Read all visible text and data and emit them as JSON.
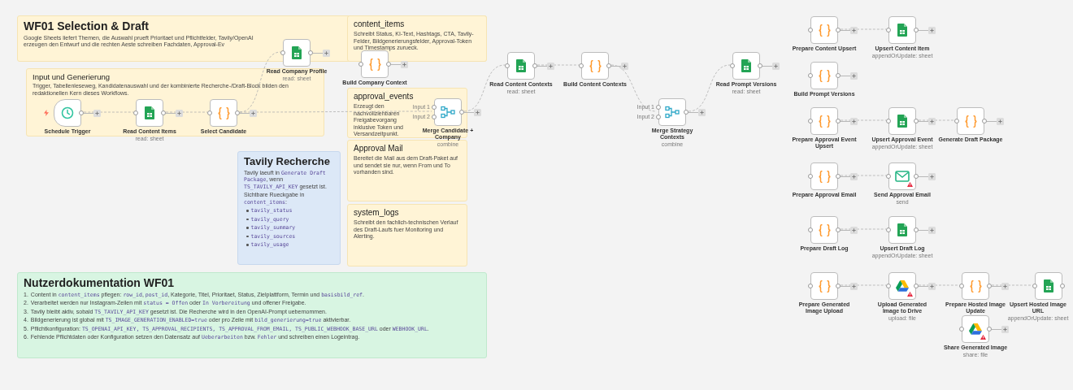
{
  "notes": [
    {
      "kind": "yellow",
      "title": "WF01 Selection & Draft",
      "blocks": [
        {
          "kind": "p",
          "parts": [
            {
              "text": "Google Sheets liefert Themen, die Auswahl prueft Prioritaet und Pflichtfelder, Tavily/OpenAI erzeugen den Entwurf und die rechten Aeste schreiben Fachdaten, Approval-Ev"
            }
          ]
        }
      ]
    },
    {
      "kind": "yellow",
      "title": "content_items",
      "blocks": [
        {
          "kind": "p",
          "parts": [
            {
              "text": "Schreibt Status, KI-Text, Hashtags, CTA, Tavily-Felder, Bildgenerierungsfelder, Approval-Token und Timestamps zurueck."
            }
          ]
        }
      ]
    },
    {
      "kind": "yellow",
      "title": "Input und Generierung",
      "blocks": [
        {
          "kind": "p",
          "parts": [
            {
              "text": "Trigger, Tabellenleseweg, Kandidatenauswahl und der kombinierte Recherche-/Draft-Block bilden den redaktionellen Kern dieses Workflows."
            }
          ]
        }
      ]
    },
    {
      "kind": "yellow",
      "title": "approval_events",
      "blocks": [
        {
          "kind": "p",
          "parts": [
            {
              "text": "Erzeugt den nachvollziehbaren Freigabevorgang inklusive Token und Versandzeitpunkt."
            }
          ]
        }
      ]
    },
    {
      "kind": "blue",
      "title": "Tavily Recherche",
      "blocks": [
        {
          "kind": "p",
          "parts": [
            {
              "text": "Tavily laeuft in "
            },
            {
              "text": "Generate Draft Package",
              "code": true
            },
            {
              "text": ", wenn "
            },
            {
              "text": "TS_TAVILY_API_KEY",
              "code": true
            },
            {
              "text": " gesetzt ist."
            }
          ]
        },
        {
          "kind": "p",
          "parts": [
            {
              "text": "Sichtbare Rueckgabe in "
            },
            {
              "text": "content_items",
              "code": true
            },
            {
              "text": ":"
            }
          ]
        },
        {
          "kind": "bullet",
          "parts": [
            {
              "text": "tavily_status",
              "code": true
            }
          ]
        },
        {
          "kind": "bullet",
          "parts": [
            {
              "text": "tavily_query",
              "code": true
            }
          ]
        },
        {
          "kind": "bullet",
          "parts": [
            {
              "text": "tavily_summary",
              "code": true
            }
          ]
        },
        {
          "kind": "bullet",
          "parts": [
            {
              "text": "tavily_sources",
              "code": true
            }
          ]
        },
        {
          "kind": "bullet",
          "parts": [
            {
              "text": "tavily_usage",
              "code": true
            }
          ]
        }
      ]
    },
    {
      "kind": "yellow",
      "title": "Approval Mail",
      "blocks": [
        {
          "kind": "p",
          "parts": [
            {
              "text": "Bereitet die Mail aus dem Draft-Paket auf und sendet sie nur, wenn From und To vorhanden sind."
            }
          ]
        }
      ]
    },
    {
      "kind": "yellow",
      "title": "system_logs",
      "blocks": [
        {
          "kind": "p",
          "parts": [
            {
              "text": "Schreibt den fachlich-technischen Verlauf des Draft-Laufs fuer Monitoring und Alerting."
            }
          ]
        }
      ]
    },
    {
      "kind": "green",
      "title": "Nutzerdokumentation WF01",
      "blocks": [
        {
          "kind": "numbered",
          "marker": "1.",
          "parts": [
            {
              "text": "Content in "
            },
            {
              "text": "content_items",
              "code": true
            },
            {
              "text": " pflegen: "
            },
            {
              "text": "row_id",
              "code": true
            },
            {
              "text": ", "
            },
            {
              "text": "post_id",
              "code": true
            },
            {
              "text": ", Kategorie, Titel, Prioritaet, Status, Zielplattform, Termin und "
            },
            {
              "text": "basisbild_ref",
              "code": true
            },
            {
              "text": "."
            }
          ]
        },
        {
          "kind": "numbered",
          "marker": "2.",
          "parts": [
            {
              "text": "Verarbeitet werden nur Instagram-Zeilen mit "
            },
            {
              "text": "status = Offen",
              "code": true
            },
            {
              "text": " oder "
            },
            {
              "text": "In Vorbereitung",
              "code": true
            },
            {
              "text": " und offener Freigabe."
            }
          ]
        },
        {
          "kind": "numbered",
          "marker": "3.",
          "parts": [
            {
              "text": "Tavily bleibt aktiv, sobald "
            },
            {
              "text": "TS_TAVILY_API_KEY",
              "code": true
            },
            {
              "text": " gesetzt ist. Die Recherche wird in den OpenAI-Prompt uebernommen."
            }
          ]
        },
        {
          "kind": "numbered",
          "marker": "4.",
          "parts": [
            {
              "text": "Bildgenerierung ist global mit "
            },
            {
              "text": "TS_IMAGE_GENERATION_ENABLED=true",
              "code": true
            },
            {
              "text": " oder pro Zeile mit "
            },
            {
              "text": "bild_generierung=true",
              "code": true
            },
            {
              "text": " aktivierbar."
            }
          ]
        },
        {
          "kind": "numbered",
          "marker": "5.",
          "parts": [
            {
              "text": "Pflichtkonfiguration: "
            },
            {
              "text": "TS_OPENAI_API_KEY, TS_APPROVAL_RECIPIENTS, TS_APPROVAL_FROM_EMAIL, TS_PUBLIC_WEBHOOK_BASE_URL",
              "code": true
            },
            {
              "text": " oder "
            },
            {
              "text": "WEBHOOK_URL",
              "code": true
            },
            {
              "text": "."
            }
          ]
        },
        {
          "kind": "numbered",
          "marker": "6.",
          "parts": [
            {
              "text": "Fehlende Pflichtdaten oder Konfiguration setzen den Datensatz auf "
            },
            {
              "text": "Ueberarbeiten",
              "code": true
            },
            {
              "text": " bzw. "
            },
            {
              "text": "Fehler",
              "code": true
            },
            {
              "text": " und schreiben einen Logeintrag."
            }
          ]
        }
      ]
    }
  ],
  "nodes": [
    {
      "label": "Schedule Trigger",
      "kind": "clock",
      "trigger": true
    },
    {
      "label": "Read Content Items",
      "kind": "sheets",
      "subtitle": "read: sheet"
    },
    {
      "label": "Select Candidate",
      "kind": "code"
    },
    {
      "label": "Read Company Profile",
      "kind": "sheets",
      "subtitle": "read: sheet"
    },
    {
      "label": "Build Company Context",
      "kind": "code"
    },
    {
      "label": "Merge Candidate + Company",
      "kind": "merge",
      "subtitle": "combine",
      "inputs": [
        "Input 1",
        "Input 2"
      ]
    },
    {
      "label": "Read Content Contexts",
      "kind": "sheets",
      "subtitle": "read: sheet"
    },
    {
      "label": "Build Content Contexts",
      "kind": "code"
    },
    {
      "label": "Merge Strategy Contexts",
      "kind": "merge",
      "subtitle": "combine",
      "inputs": [
        "Input 1",
        "Input 2"
      ]
    },
    {
      "label": "Read Prompt Versions",
      "kind": "sheets",
      "subtitle": "read: sheet"
    },
    {
      "label": "Prepare Content Upsert",
      "kind": "code"
    },
    {
      "label": "Build Prompt Versions",
      "kind": "code"
    },
    {
      "label": "Upsert Content Item",
      "kind": "sheets",
      "subtitle": "appendOrUpdate: sheet"
    },
    {
      "label": "Prepare Approval Event Upsert",
      "kind": "code"
    },
    {
      "label": "Upsert Approval Event",
      "kind": "sheets",
      "subtitle": "appendOrUpdate: sheet"
    },
    {
      "label": "Generate Draft Package",
      "kind": "code"
    },
    {
      "label": "Prepare Approval Email",
      "kind": "code"
    },
    {
      "label": "Send Approval Email",
      "kind": "mail",
      "subtitle": "send",
      "warning": true
    },
    {
      "label": "Prepare Draft Log",
      "kind": "code"
    },
    {
      "label": "Upsert Draft Log",
      "kind": "sheets",
      "subtitle": "appendOrUpdate: sheet"
    },
    {
      "label": "Prepare Generated Image Upload",
      "kind": "code"
    },
    {
      "label": "Upload Generated Image to Drive",
      "kind": "drive",
      "subtitle": "upload: file",
      "warning": true
    },
    {
      "label": "Prepare Hosted Image Update",
      "kind": "code"
    },
    {
      "label": "Share Generated Image",
      "kind": "drive",
      "subtitle": "share: file",
      "warning": true
    },
    {
      "label": "Upsert Hosted Image URL",
      "kind": "sheets",
      "subtitle": "appendOrUpdate: sheet"
    }
  ]
}
